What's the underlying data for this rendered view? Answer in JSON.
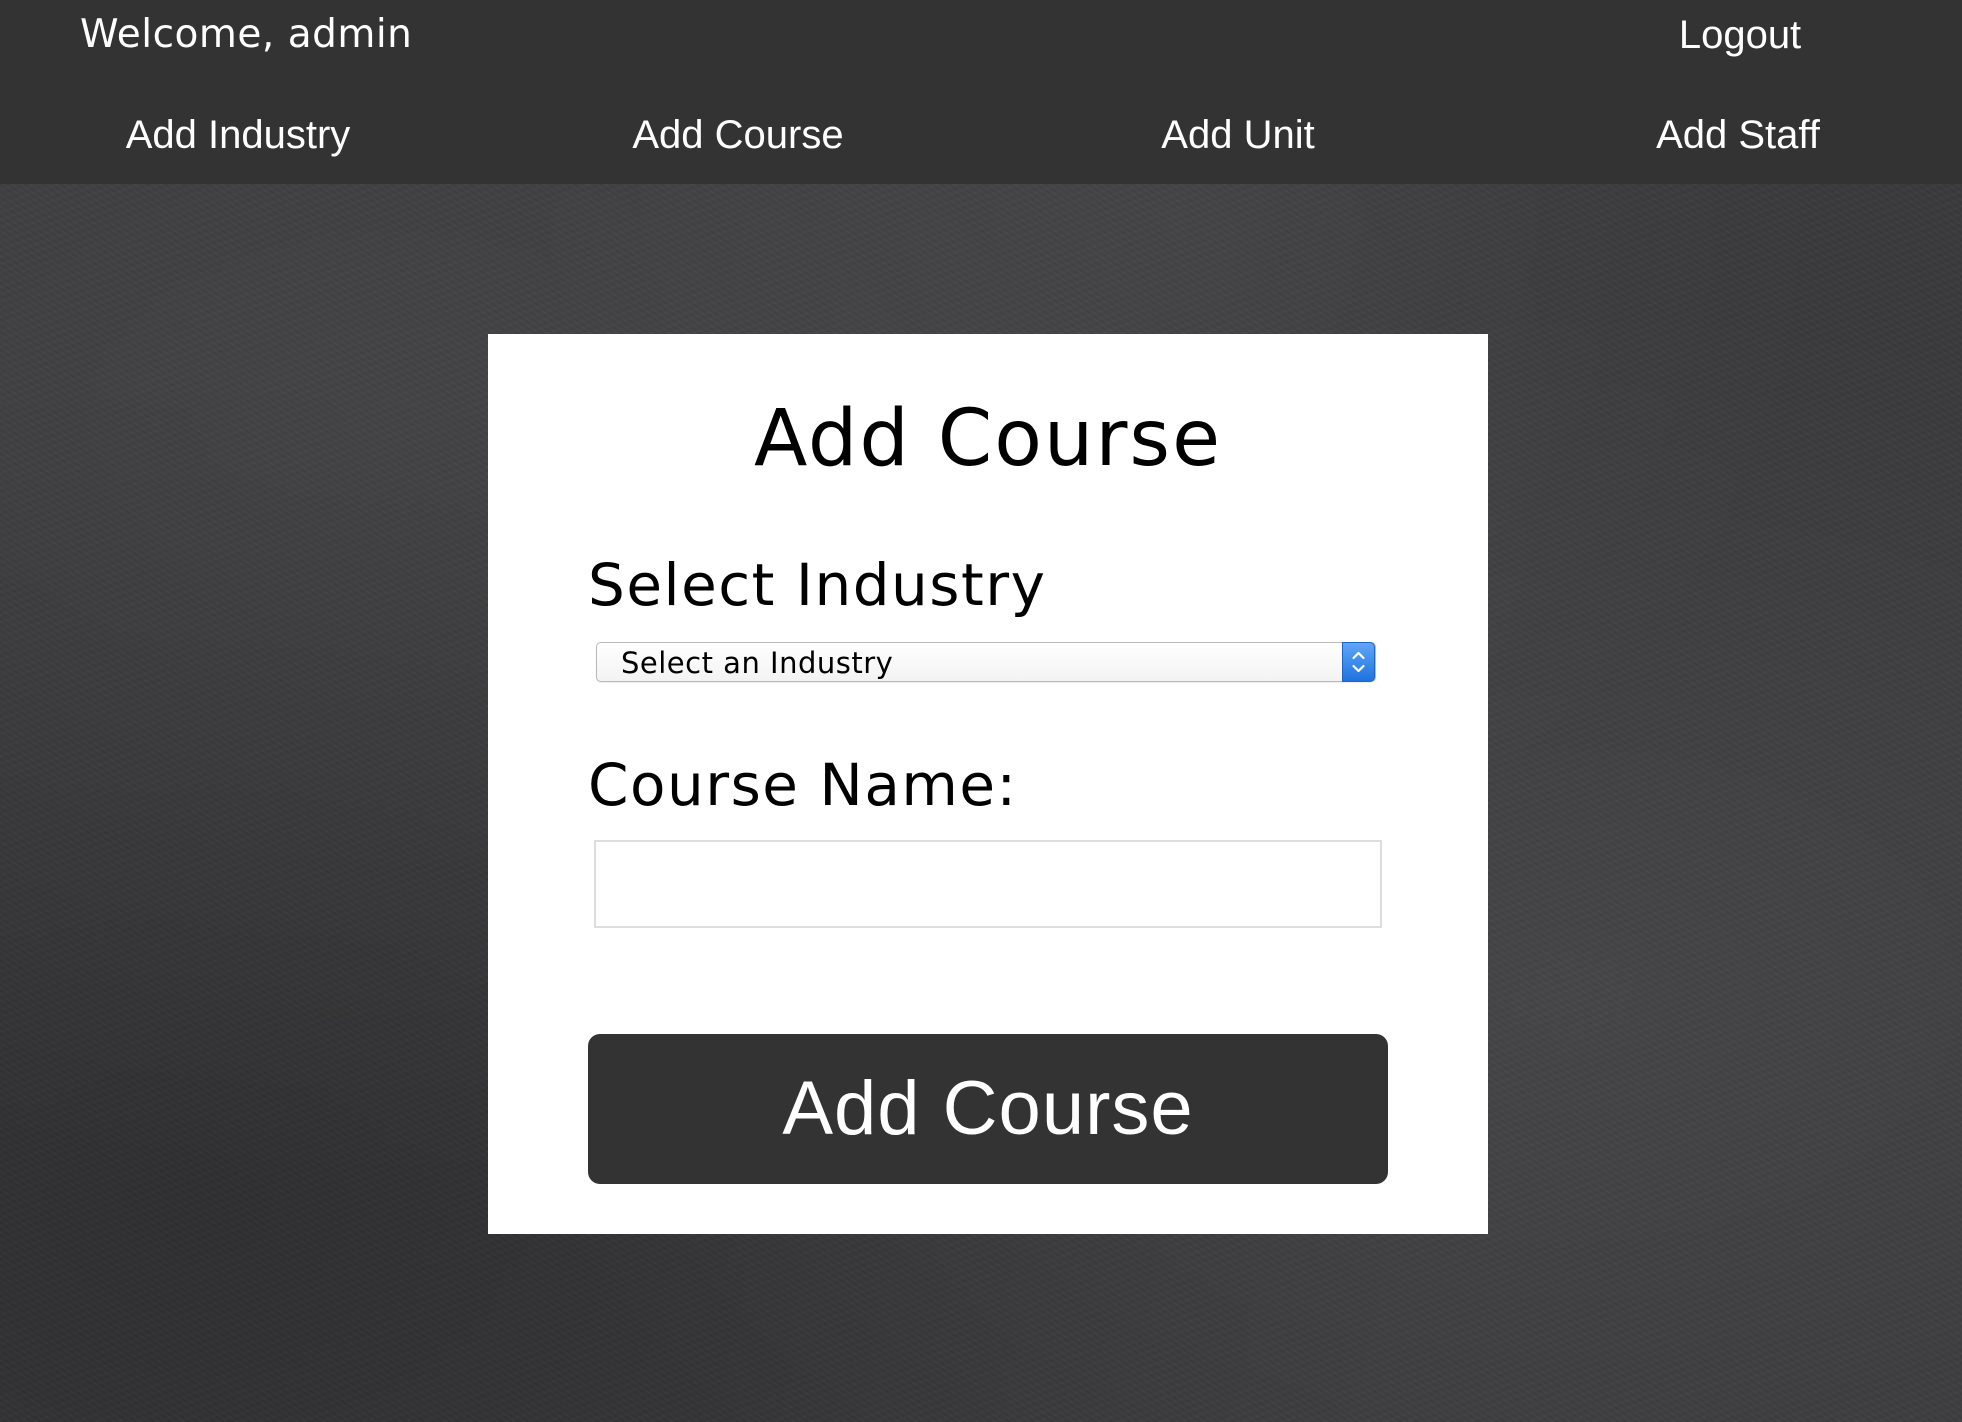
{
  "header": {
    "welcome_text": "Welcome, admin",
    "logout_label": "Logout",
    "nav": {
      "add_industry": "Add Industry",
      "add_course": "Add Course",
      "add_unit": "Add Unit",
      "add_staff": "Add Staff"
    }
  },
  "form": {
    "title": "Add Course",
    "industry_label": "Select Industry",
    "industry_select": {
      "selected": "Select an Industry"
    },
    "course_name_label": "Course Name:",
    "course_name_value": "",
    "submit_label": "Add Course"
  },
  "icons": {
    "select_arrows": "up-down-chevron-icon"
  },
  "colors": {
    "nav_background": "#333333",
    "card_background": "#ffffff",
    "button_background": "#333333",
    "select_accent": "#2a7de1"
  }
}
